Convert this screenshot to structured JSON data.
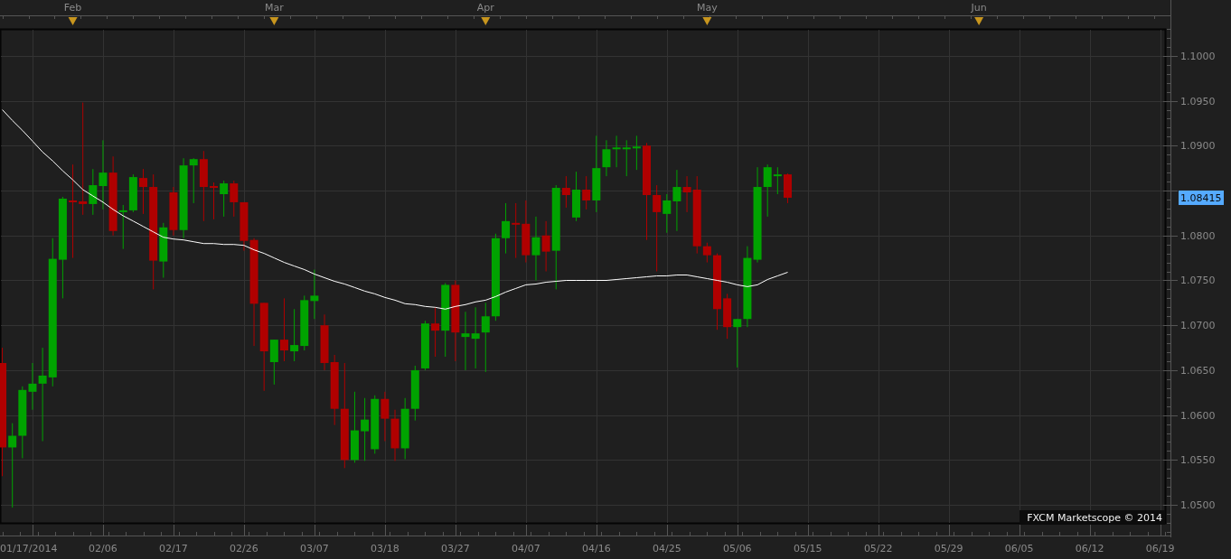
{
  "chart": {
    "chart_data": {
      "type": "candlestick",
      "grid": true,
      "ylim": [
        1.0479,
        1.103
      ],
      "categories": [
        null,
        null,
        null,
        "01/17/2014",
        null,
        null,
        null,
        null,
        null,
        null,
        "02/06",
        null,
        null,
        null,
        null,
        null,
        null,
        "02/17",
        null,
        null,
        null,
        null,
        null,
        null,
        "02/26",
        null,
        null,
        null,
        null,
        null,
        null,
        "03/07",
        null,
        null,
        null,
        null,
        null,
        null,
        "03/18",
        null,
        null,
        null,
        null,
        null,
        null,
        "03/27",
        null,
        null,
        null,
        null,
        null,
        null,
        "04/07",
        null,
        null,
        null,
        null,
        null,
        null,
        "04/16",
        null,
        null,
        null,
        null,
        null,
        null,
        "04/25",
        null,
        null,
        null,
        null,
        null,
        null,
        "05/06",
        null,
        null,
        null,
        null,
        null,
        null,
        "05/15",
        null,
        null,
        null,
        null,
        null,
        null,
        "05/22",
        null,
        null,
        null,
        null,
        null,
        null,
        "05/29",
        null,
        null,
        null,
        null,
        null,
        null,
        "06/05",
        null,
        null,
        null,
        null,
        null,
        null,
        "06/12",
        null,
        null,
        null,
        null,
        null,
        null,
        "06/19"
      ],
      "yticks": [
        {
          "value": 1.05,
          "label": "1.0500"
        },
        {
          "value": 1.055,
          "label": "1.0550"
        },
        {
          "value": 1.06,
          "label": "1.0600"
        },
        {
          "value": 1.065,
          "label": "1.0650"
        },
        {
          "value": 1.07,
          "label": "1.0700"
        },
        {
          "value": 1.075,
          "label": "1.0750"
        },
        {
          "value": 1.08,
          "label": "1.0800"
        },
        {
          "value": 1.09,
          "label": "1.0900"
        },
        {
          "value": 1.095,
          "label": "1.0950"
        },
        {
          "value": 1.1,
          "label": "1.1000"
        }
      ],
      "ohlc": [
        [
          1.0658,
          1.0675,
          1.0532,
          1.0564
        ],
        [
          1.0564,
          1.0591,
          1.0497,
          1.0577
        ],
        [
          1.0577,
          1.0632,
          1.0552,
          1.0628
        ],
        [
          1.0626,
          1.0658,
          1.0606,
          1.0635
        ],
        [
          1.0635,
          1.0675,
          1.0571,
          1.0644
        ],
        [
          1.0642,
          1.0797,
          1.0632,
          1.0774
        ],
        [
          1.0773,
          1.0843,
          1.073,
          1.0841
        ],
        [
          1.0839,
          1.0879,
          1.0775,
          1.0838
        ],
        [
          1.0838,
          1.0948,
          1.0823,
          1.0835
        ],
        [
          1.0835,
          1.0874,
          1.0823,
          1.0856
        ],
        [
          1.0855,
          1.0906,
          1.0829,
          1.087
        ],
        [
          1.087,
          1.0888,
          1.08,
          1.0805
        ],
        [
          1.0827,
          1.0834,
          1.0785,
          1.0828
        ],
        [
          1.0828,
          1.0868,
          1.0826,
          1.0865
        ],
        [
          1.0864,
          1.0874,
          1.0824,
          1.0854
        ],
        [
          1.0854,
          1.0868,
          1.074,
          1.0772
        ],
        [
          1.0771,
          1.0814,
          1.0753,
          1.0809
        ],
        [
          1.0848,
          1.0854,
          1.08,
          1.0806
        ],
        [
          1.0806,
          1.0886,
          1.0797,
          1.0878
        ],
        [
          1.0878,
          1.0886,
          1.0836,
          1.0885
        ],
        [
          1.0885,
          1.0894,
          1.0816,
          1.0854
        ],
        [
          1.0855,
          1.0859,
          1.0818,
          1.0853
        ],
        [
          1.0846,
          1.0861,
          1.0821,
          1.0858
        ],
        [
          1.0858,
          1.0861,
          1.0821,
          1.0837
        ],
        [
          1.0837,
          1.0837,
          1.0783,
          1.0794
        ],
        [
          1.0795,
          1.0797,
          1.0677,
          1.0724
        ],
        [
          1.0725,
          1.0725,
          1.0627,
          1.0671
        ],
        [
          1.0659,
          1.0684,
          1.0634,
          1.0684
        ],
        [
          1.0684,
          1.073,
          1.066,
          1.0672
        ],
        [
          1.0671,
          1.0718,
          1.066,
          1.0678
        ],
        [
          1.0677,
          1.0733,
          1.0672,
          1.0728
        ],
        [
          1.0727,
          1.0762,
          1.0707,
          1.0733
        ],
        [
          1.07,
          1.0712,
          1.065,
          1.0658
        ],
        [
          1.0659,
          1.0667,
          1.0589,
          1.0607
        ],
        [
          1.0607,
          1.0658,
          1.0541,
          1.055
        ],
        [
          1.055,
          1.0626,
          1.0547,
          1.0583
        ],
        [
          1.0582,
          1.0619,
          1.0549,
          1.0595
        ],
        [
          1.0562,
          1.0622,
          1.0557,
          1.0618
        ],
        [
          1.0618,
          1.0626,
          1.0571,
          1.0596
        ],
        [
          1.0596,
          1.0606,
          1.0549,
          1.0563
        ],
        [
          1.0563,
          1.0619,
          1.0551,
          1.0607
        ],
        [
          1.0607,
          1.0655,
          1.0594,
          1.065
        ],
        [
          1.0652,
          1.0705,
          1.065,
          1.0702
        ],
        [
          1.0702,
          1.072,
          1.0665,
          1.0694
        ],
        [
          1.0694,
          1.0747,
          1.0665,
          1.0745
        ],
        [
          1.0745,
          1.075,
          1.066,
          1.0692
        ],
        [
          1.0687,
          1.0715,
          1.065,
          1.0691
        ],
        [
          1.0685,
          1.072,
          1.0652,
          1.0691
        ],
        [
          1.0692,
          1.0725,
          1.0648,
          1.071
        ],
        [
          1.071,
          1.0802,
          1.0705,
          1.0797
        ],
        [
          1.0797,
          1.0836,
          1.078,
          1.0816
        ],
        [
          1.0814,
          1.0836,
          1.0775,
          1.0812
        ],
        [
          1.0813,
          1.0839,
          1.077,
          1.0778
        ],
        [
          1.0778,
          1.0821,
          1.075,
          1.0798
        ],
        [
          1.08,
          1.0816,
          1.076,
          1.0782
        ],
        [
          1.0783,
          1.0856,
          1.074,
          1.0853
        ],
        [
          1.0853,
          1.0866,
          1.0831,
          1.0845
        ],
        [
          1.082,
          1.0871,
          1.0816,
          1.0851
        ],
        [
          1.0851,
          1.0866,
          1.0829,
          1.0839
        ],
        [
          1.0839,
          1.0911,
          1.0826,
          1.0875
        ],
        [
          1.0876,
          1.0906,
          1.0866,
          1.0896
        ],
        [
          1.0896,
          1.0911,
          1.0876,
          1.0898
        ],
        [
          1.0897,
          1.0906,
          1.0866,
          1.0898
        ],
        [
          1.0897,
          1.0911,
          1.0873,
          1.0899
        ],
        [
          1.09,
          1.0903,
          1.0795,
          1.0845
        ],
        [
          1.0845,
          1.0856,
          1.076,
          1.0826
        ],
        [
          1.0824,
          1.0846,
          1.0803,
          1.0839
        ],
        [
          1.0838,
          1.0873,
          1.0805,
          1.0854
        ],
        [
          1.0854,
          1.0866,
          1.0826,
          1.0848
        ],
        [
          1.0851,
          1.0866,
          1.078,
          1.0788
        ],
        [
          1.0788,
          1.0792,
          1.077,
          1.0778
        ],
        [
          1.0778,
          1.078,
          1.0695,
          1.0718
        ],
        [
          1.073,
          1.0735,
          1.0685,
          1.0698
        ],
        [
          1.0698,
          1.0707,
          1.0653,
          1.0707
        ],
        [
          1.0707,
          1.0788,
          1.0698,
          1.0775
        ],
        [
          1.0773,
          1.0876,
          1.077,
          1.0854
        ],
        [
          1.0854,
          1.0879,
          1.0821,
          1.0876
        ],
        [
          1.0866,
          1.0876,
          1.0846,
          1.0868
        ],
        [
          1.0868,
          1.0869,
          1.0836,
          1.0842
        ],
        null,
        null,
        null,
        null,
        null,
        null,
        null,
        null,
        null,
        null,
        null,
        null,
        null,
        null,
        null,
        null,
        null,
        null,
        null,
        null,
        null,
        null,
        null,
        null,
        null,
        null,
        null,
        null,
        null,
        null,
        null,
        null,
        null,
        null,
        null,
        null,
        null
      ],
      "series": [
        {
          "type": "line",
          "color": "#ffffff",
          "values": [
            1.094,
            1.0928,
            1.0917,
            1.0905,
            1.0893,
            1.0883,
            1.0872,
            1.0862,
            1.0851,
            1.0844,
            1.0837,
            1.0829,
            1.0822,
            1.0816,
            1.081,
            1.0804,
            1.0798,
            1.0796,
            1.0795,
            1.0793,
            1.0791,
            1.0791,
            1.079,
            1.079,
            1.0789,
            1.0784,
            1.078,
            1.0775,
            1.077,
            1.0766,
            1.0762,
            1.0757,
            1.0753,
            1.0749,
            1.0746,
            1.0742,
            1.0738,
            1.0735,
            1.0731,
            1.0728,
            1.0724,
            1.0723,
            1.0721,
            1.072,
            1.0718,
            1.0721,
            1.0723,
            1.0726,
            1.0728,
            1.0732,
            1.0737,
            1.0741,
            1.0745,
            1.0746,
            1.0748,
            1.0749,
            1.075,
            1.075,
            1.075,
            1.075,
            1.075,
            1.0751,
            1.0752,
            1.0753,
            1.0754,
            1.0755,
            1.0755,
            1.0756,
            1.0756,
            1.0754,
            1.0752,
            1.075,
            1.0748,
            1.0745,
            1.0743,
            1.0745,
            1.0751,
            1.0755,
            1.0759,
            null,
            null,
            null,
            null,
            null,
            null,
            null,
            null,
            null,
            null,
            null,
            null,
            null,
            null,
            null,
            null,
            null,
            null,
            null,
            null,
            null,
            null,
            null,
            null,
            null,
            null,
            null,
            null,
            null,
            null,
            null,
            null,
            null,
            null,
            null,
            null,
            null
          ]
        }
      ],
      "annotations": [
        "Feb",
        "Mar",
        "Apr",
        "May",
        "Jun"
      ]
    },
    "price_marker": "1.08415",
    "copyright": "FXCM Marketscope © 2014"
  }
}
